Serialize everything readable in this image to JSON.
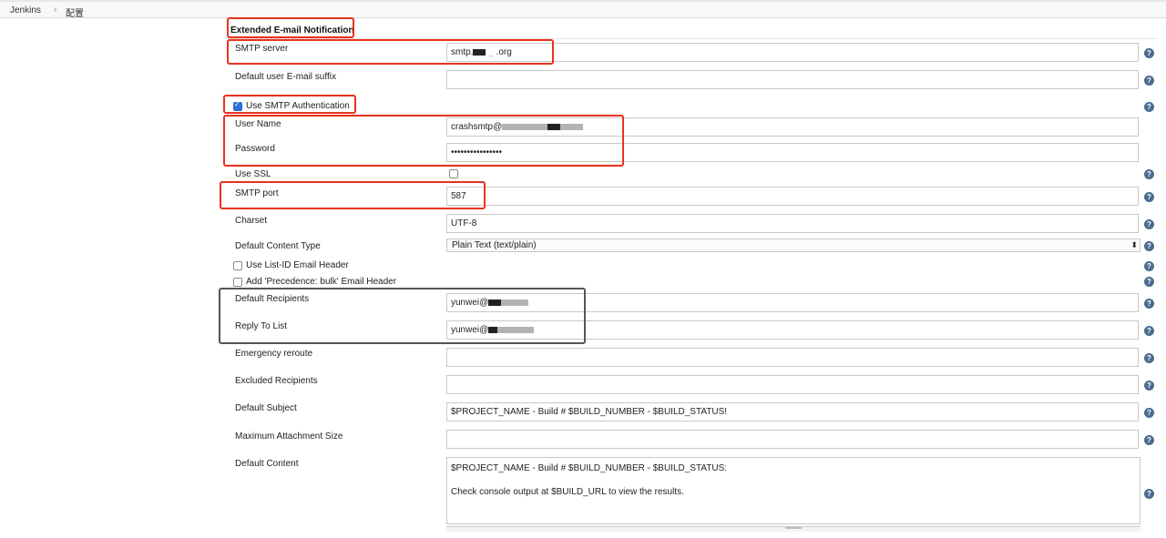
{
  "breadcrumb": {
    "home": "Jenkins",
    "separator": "›",
    "current": "配置"
  },
  "section": {
    "title": "Extended E-mail Notification"
  },
  "fields": {
    "smtp_server": {
      "label": "SMTP server",
      "value": "smtp.",
      "value_suffix": ".org"
    },
    "default_suffix": {
      "label": "Default user E-mail suffix",
      "value": ""
    },
    "use_smtp_auth": {
      "label": "Use SMTP Authentication",
      "checked": true
    },
    "user_name": {
      "label": "User Name",
      "value": "crashsmtp@"
    },
    "password": {
      "label": "Password",
      "value": "••••••••••••••••"
    },
    "use_ssl": {
      "label": "Use SSL",
      "checked": false
    },
    "smtp_port": {
      "label": "SMTP port",
      "value": "587"
    },
    "charset": {
      "label": "Charset",
      "value": "UTF-8"
    },
    "content_type": {
      "label": "Default Content Type",
      "value": "Plain Text (text/plain)"
    },
    "list_id": {
      "label": "Use List-ID Email Header",
      "checked": false
    },
    "precedence": {
      "label": "Add 'Precedence: bulk' Email Header",
      "checked": false
    },
    "default_recipients": {
      "label": "Default Recipients",
      "value": "yunwei@"
    },
    "reply_to": {
      "label": "Reply To List",
      "value": "yunwei@"
    },
    "emergency_reroute": {
      "label": "Emergency reroute",
      "value": ""
    },
    "excluded_recipients": {
      "label": "Excluded Recipients",
      "value": ""
    },
    "default_subject": {
      "label": "Default Subject",
      "value": "$PROJECT_NAME - Build # $BUILD_NUMBER - $BUILD_STATUS!"
    },
    "max_attachment": {
      "label": "Maximum Attachment Size",
      "value": ""
    },
    "default_content": {
      "label": "Default Content",
      "line1": "$PROJECT_NAME - Build # $BUILD_NUMBER - $BUILD_STATUS:",
      "line2": "Check console output at $BUILD_URL to view the results."
    }
  },
  "help_icon": "?",
  "colors": {
    "highlight_red": "#e8321e",
    "highlight_gray": "#555555",
    "help_blue": "#4a6c91"
  }
}
